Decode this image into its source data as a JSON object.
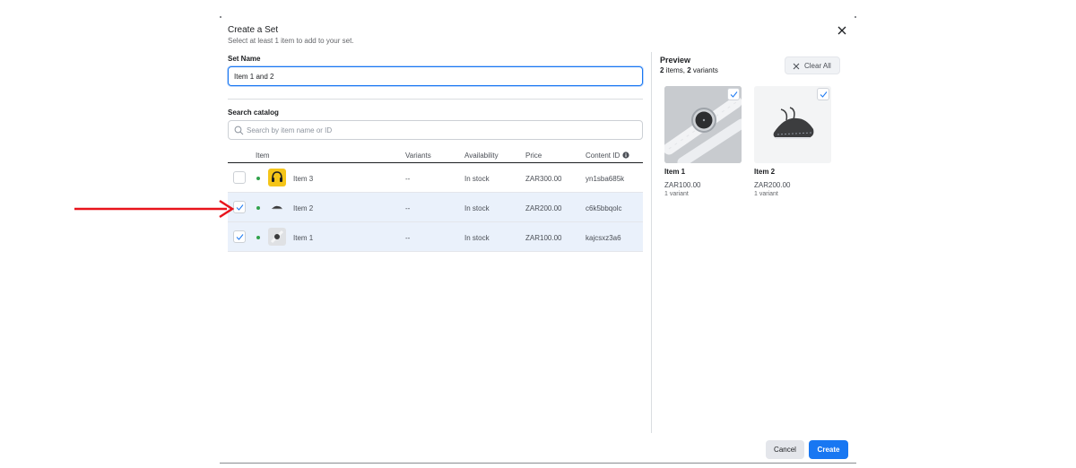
{
  "dialog": {
    "title": "Create a Set",
    "subtitle": "Select at least 1 item to add to your set.",
    "close_icon": "close-icon"
  },
  "set_name": {
    "label": "Set Name",
    "value": "Item 1 and 2"
  },
  "search": {
    "label": "Search catalog",
    "placeholder": "Search by item name or ID",
    "icon": "search-icon"
  },
  "table": {
    "columns": {
      "item": "Item",
      "variants": "Variants",
      "availability": "Availability",
      "price": "Price",
      "content_id": "Content ID"
    },
    "rows": [
      {
        "name": "Item 3",
        "variants": "--",
        "availability": "In stock",
        "price": "ZAR300.00",
        "content_id": "yn1sba685k",
        "checked": false,
        "thumb": "headphones-icon"
      },
      {
        "name": "Item 2",
        "variants": "--",
        "availability": "In stock",
        "price": "ZAR200.00",
        "content_id": "c6k5bbqolc",
        "checked": true,
        "thumb": "sneaker-icon"
      },
      {
        "name": "Item 1",
        "variants": "--",
        "availability": "In stock",
        "price": "ZAR100.00",
        "content_id": "kajcsxz3a6",
        "checked": true,
        "thumb": "watch-icon"
      }
    ]
  },
  "preview": {
    "title": "Preview",
    "items_count": "2",
    "items_word": " items, ",
    "variants_count": "2",
    "variants_word": " variants",
    "clear_label": "Clear All",
    "cards": [
      {
        "name": "Item 1",
        "price": "ZAR100.00",
        "variant": "1 variant",
        "image": "watch-image"
      },
      {
        "name": "Item 2",
        "price": "ZAR200.00",
        "variant": "1 variant",
        "image": "sneaker-image"
      }
    ]
  },
  "footer": {
    "cancel_label": "Cancel",
    "create_label": "Create"
  },
  "colors": {
    "primary": "#1877f2",
    "selected_row": "#eaf1fb",
    "in_stock_dot": "#31a24c",
    "annotation_arrow": "#e8141c"
  }
}
